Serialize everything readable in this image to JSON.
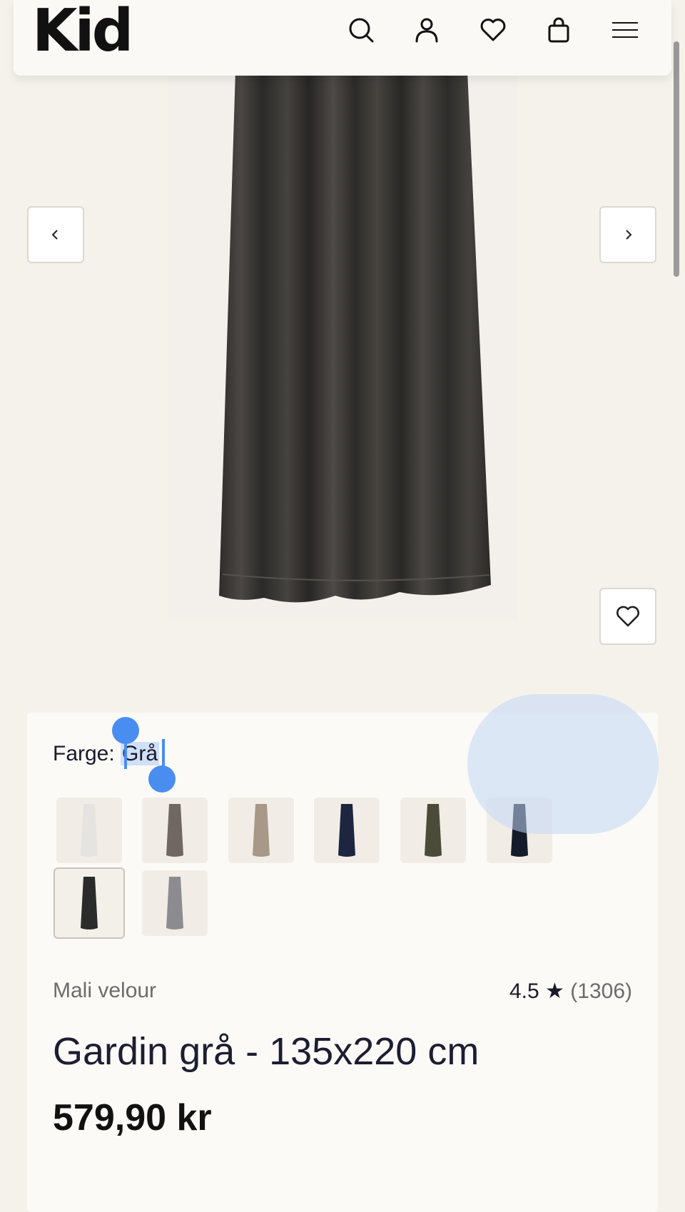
{
  "header": {
    "logo": "Kid",
    "icons": [
      "search-icon",
      "account-icon",
      "wishlist-icon",
      "cart-icon",
      "menu-icon"
    ]
  },
  "gallery": {
    "image": "curtain-image",
    "prev_icon": "chevron-left-icon",
    "next_icon": "chevron-right-icon",
    "favorite_icon": "heart-icon"
  },
  "product": {
    "color_label": "Farge: ",
    "color_value": "Grå",
    "swatches": [
      {
        "color": "#e6e4e0",
        "selected": false
      },
      {
        "color": "#6f6862",
        "selected": false
      },
      {
        "color": "#a89888",
        "selected": false
      },
      {
        "color": "#1d2540",
        "selected": false
      },
      {
        "color": "#4a4b38",
        "selected": false
      },
      {
        "color": "#151b28",
        "selected": false
      },
      {
        "color": "#2b2b2b",
        "selected": true
      },
      {
        "color": "#8c8c90",
        "selected": false
      }
    ],
    "brand": "Mali velour",
    "rating": "4.5 ★",
    "review_count": "(1306)",
    "title": "Gardin grå - 135x220 cm",
    "price": "579,90 kr"
  },
  "colors": {
    "background": "#f5f2ec",
    "card": "#fbfaf6",
    "selection": "#4a8df0"
  }
}
